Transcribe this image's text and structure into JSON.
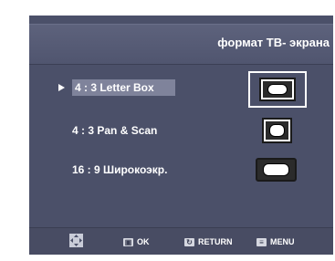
{
  "header": {
    "title": "формат ТВ- экрана"
  },
  "options": [
    {
      "label": "4 : 3  Letter Box",
      "selected": true,
      "icon": "tv-letterbox-icon"
    },
    {
      "label": "4 : 3  Pan & Scan",
      "selected": false,
      "icon": "tv-panscan-icon"
    },
    {
      "label": "16 : 9  Широкоэкр.",
      "selected": false,
      "icon": "tv-wide-icon"
    }
  ],
  "footer": {
    "move_icon": "directional-pad-icon",
    "ok_label": "OK",
    "return_label": "RETURN",
    "menu_label": "MENU"
  },
  "colors": {
    "background": "#4b5069",
    "highlight": "#7f839b",
    "text": "#ffffff"
  }
}
